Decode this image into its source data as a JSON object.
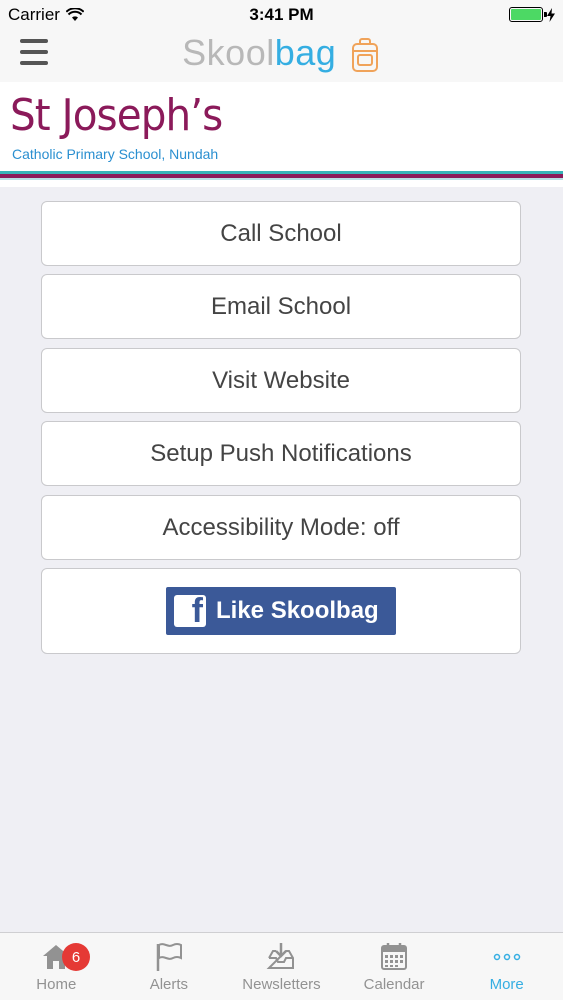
{
  "status_bar": {
    "carrier": "Carrier",
    "time": "3:41 PM"
  },
  "nav": {
    "logo_part1": "Skool",
    "logo_part2": "bag"
  },
  "banner": {
    "school_name": "St Joseph’s",
    "school_subtitle": "Catholic Primary School, Nundah"
  },
  "buttons": {
    "call": "Call School",
    "email": "Email School",
    "website": "Visit Website",
    "push": "Setup Push Notifications",
    "accessibility": "Accessibility Mode: off",
    "facebook": "Like Skoolbag"
  },
  "tabs": [
    {
      "label": "Home",
      "badge": "6",
      "icon": "home-icon"
    },
    {
      "label": "Alerts",
      "icon": "flag-icon"
    },
    {
      "label": "Newsletters",
      "icon": "inbox-download-icon"
    },
    {
      "label": "Calendar",
      "icon": "calendar-icon"
    },
    {
      "label": "More",
      "icon": "more-dots-icon",
      "active": true
    }
  ],
  "colors": {
    "accent": "#35aee2",
    "school_primary": "#8b1a5a",
    "facebook": "#3b5998",
    "badge": "#e53935"
  }
}
